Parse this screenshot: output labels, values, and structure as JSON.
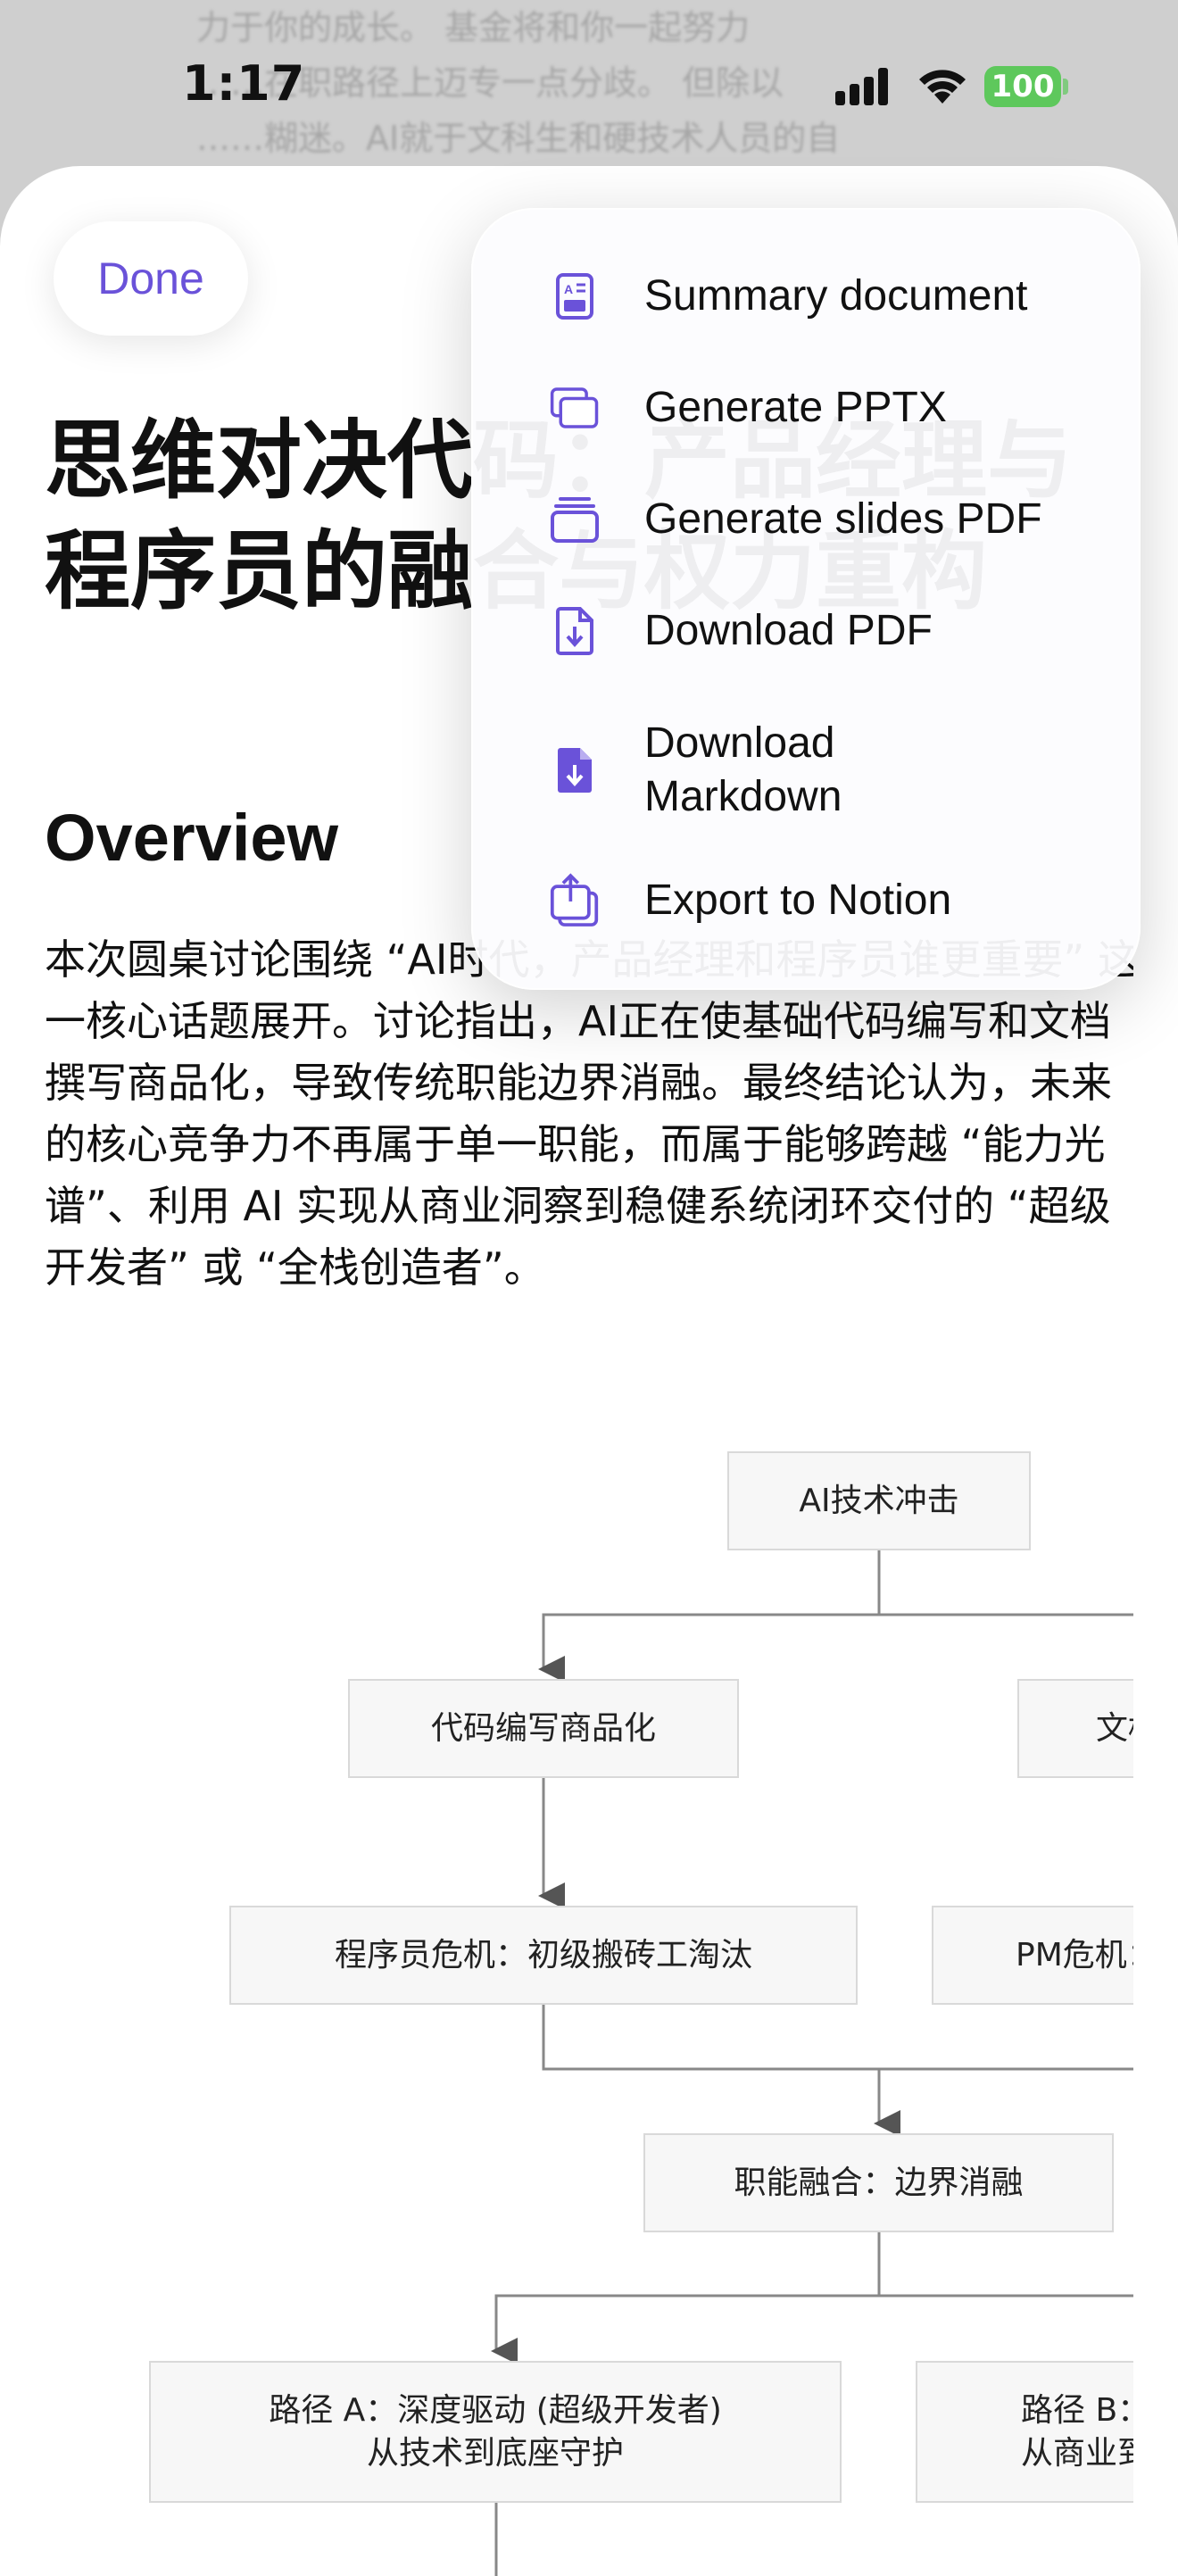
{
  "status_bar": {
    "time": "1:17",
    "battery": "100"
  },
  "background_text": [
    "力于你的成长。 基金将和你一起努力",
    "……在职路径上迈专一点分歧。 但除以",
    "……糊迷。AI就于文科生和硬技术人员的自"
  ],
  "header": {
    "done_label": "Done"
  },
  "document": {
    "title": "思维对决代码：产品经理与程序员的融合与权力重构",
    "overview_heading": "Overview",
    "overview_text": "本次圆桌讨论围绕 “AI时代，产品经理和程序员谁更重要” 这一核心话题展开。讨论指出，AI正在使基础代码编写和文档撰写商品化，导致传统职能边界消融。最终结论认为，未来的核心竞争力不再属于单一职能，而属于能够跨越 “能力光谱”、利用 AI 实现从商业洞察到稳健系统闭环交付的 “超级开发者” 或 “全栈创造者”。"
  },
  "flowchart": {
    "nodes": [
      {
        "label": "AI技术冲击"
      },
      {
        "label": "代码编写商品化"
      },
      {
        "label": "文档撰写商品化"
      },
      {
        "label": "程序员危机：初级搬砖工淘汰"
      },
      {
        "label": "PM危机：文档搬运工淘汰"
      },
      {
        "label": "职能融合：边界消融"
      },
      {
        "label": "路径 A：深度驱动 (超级开发者)\n从技术到底座守护"
      },
      {
        "label": "路径 B：广度驱动 (全栈创造者)\n从商业到产品落地"
      }
    ]
  },
  "menu": {
    "items": [
      {
        "label": "Summary document",
        "icon": "summary-document-icon"
      },
      {
        "label": "Generate PPTX",
        "icon": "pptx-icon"
      },
      {
        "label": "Generate slides PDF",
        "icon": "slides-pdf-icon"
      },
      {
        "label": "Download PDF",
        "icon": "download-pdf-icon"
      },
      {
        "label": "Download\nMarkdown",
        "icon": "markdown-icon"
      },
      {
        "label": "Export to Notion",
        "icon": "notion-export-icon"
      }
    ]
  },
  "colors": {
    "accent": "#6a52d9",
    "battery": "#5ec85c"
  }
}
